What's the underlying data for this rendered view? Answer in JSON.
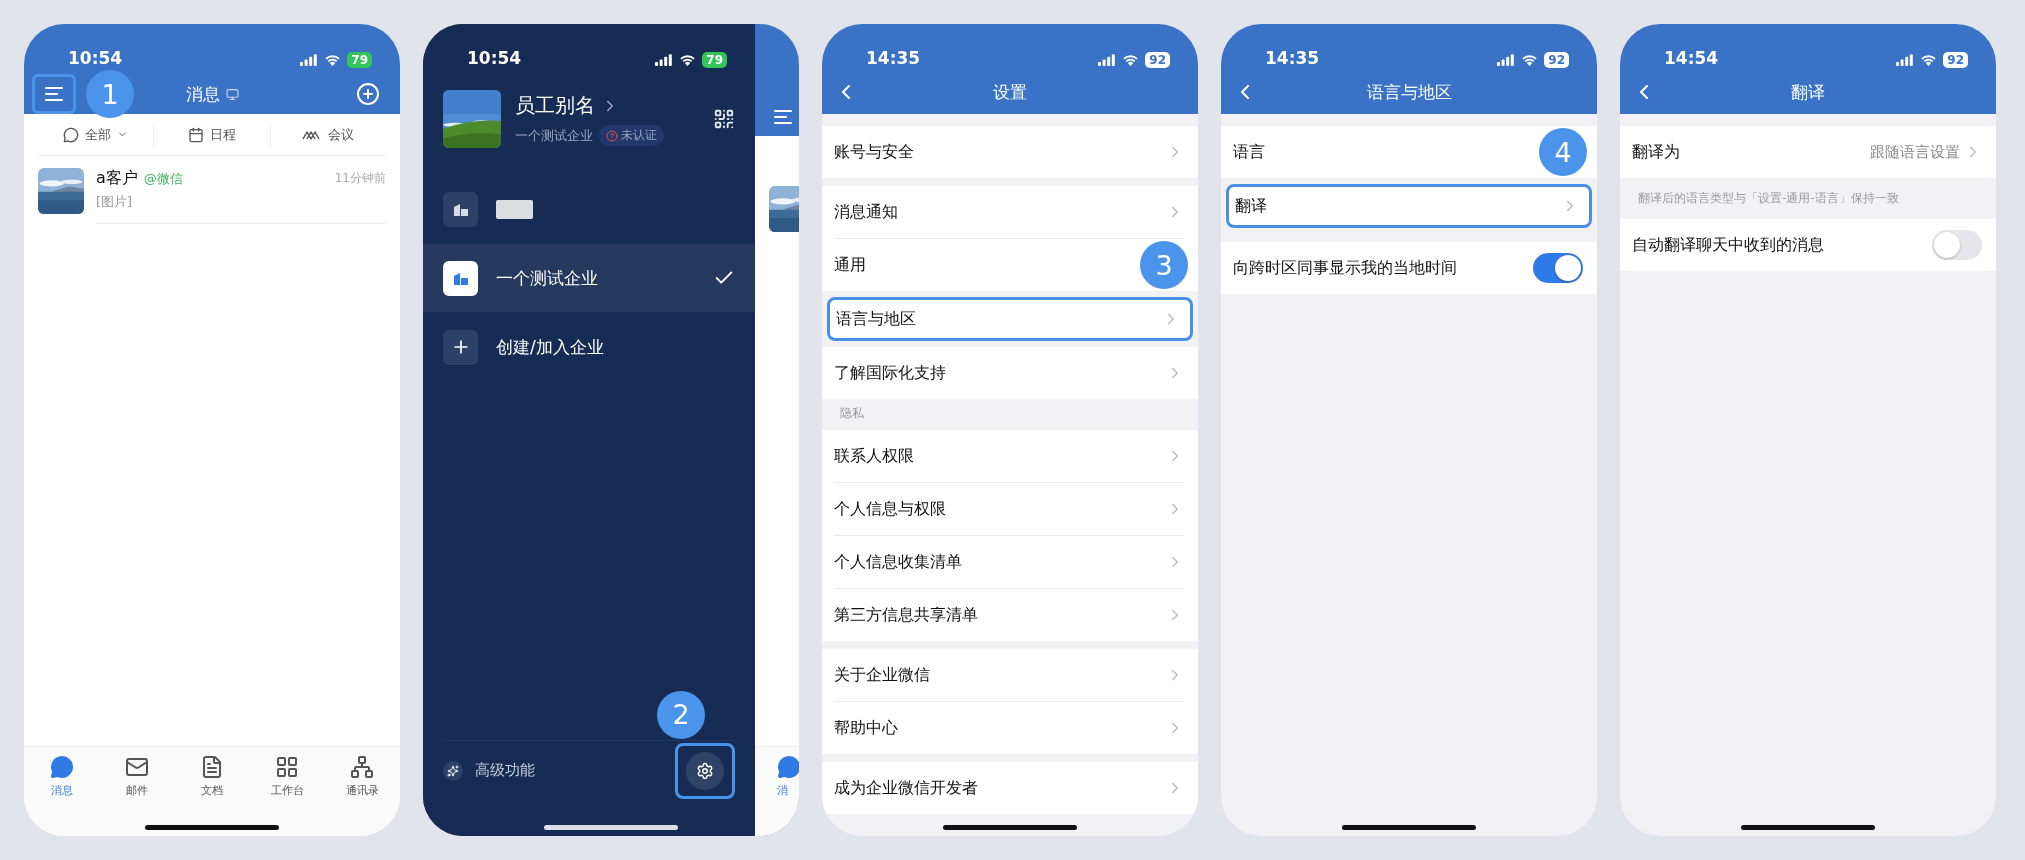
{
  "screens": [
    {
      "kind": "messages",
      "status": {
        "time": "10:54",
        "battery": "79",
        "charging": true
      },
      "title": "消息",
      "step": "1",
      "filters": [
        {
          "label": "全部",
          "dropdown": true
        },
        {
          "label": "日程",
          "dropdown": false
        },
        {
          "label": "会议",
          "dropdown": false
        }
      ],
      "chats": [
        {
          "name": "a客户",
          "source": "@微信",
          "time": "11分钟前",
          "preview": "[图片]"
        }
      ],
      "tabs": [
        {
          "label": "消息",
          "selected": true
        },
        {
          "label": "邮件",
          "selected": false
        },
        {
          "label": "文档",
          "selected": false
        },
        {
          "label": "工作台",
          "selected": false
        },
        {
          "label": "通讯录",
          "selected": false
        }
      ]
    },
    {
      "kind": "drawer",
      "status": {
        "time": "10:54",
        "battery": "79",
        "charging": true
      },
      "profile": {
        "name": "员工别名",
        "company": "一个测试企业",
        "badge": "未认证"
      },
      "orgs": [
        {
          "kind": "org",
          "redacted": true,
          "selected": false
        },
        {
          "kind": "org",
          "label": "一个测试企业",
          "redacted": false,
          "selected": true
        },
        {
          "kind": "create",
          "label": "创建/加入企业",
          "redacted": false,
          "selected": false
        }
      ],
      "footer": {
        "label": "高级功能",
        "step": "2"
      },
      "peek": {
        "tab": "消"
      }
    },
    {
      "kind": "settings",
      "status": {
        "time": "14:35",
        "battery": "92",
        "charging": false
      },
      "title": "设置",
      "groups": [
        {
          "rows": [
            {
              "kind": "link",
              "label": "账号与安全",
              "highlighted": false
            }
          ]
        },
        {
          "rows": [
            {
              "kind": "link",
              "label": "消息通知",
              "highlighted": false
            },
            {
              "kind": "link",
              "label": "通用",
              "highlighted": false,
              "step": "3"
            },
            {
              "kind": "link",
              "label": "语言与地区",
              "highlighted": true
            },
            {
              "kind": "link",
              "label": "了解国际化支持",
              "highlighted": false
            }
          ]
        },
        {
          "header": "隐私",
          "rows": [
            {
              "kind": "link",
              "label": "联系人权限",
              "highlighted": false
            },
            {
              "kind": "link",
              "label": "个人信息与权限",
              "highlighted": false
            },
            {
              "kind": "link",
              "label": "个人信息收集清单",
              "highlighted": false
            },
            {
              "kind": "link",
              "label": "第三方信息共享清单",
              "highlighted": false
            }
          ]
        },
        {
          "rows": [
            {
              "kind": "link",
              "label": "关于企业微信",
              "highlighted": false
            },
            {
              "kind": "link",
              "label": "帮助中心",
              "highlighted": false
            }
          ]
        },
        {
          "rows": [
            {
              "kind": "link",
              "label": "成为企业微信开发者",
              "highlighted": false
            }
          ]
        }
      ]
    },
    {
      "kind": "settings",
      "status": {
        "time": "14:35",
        "battery": "92",
        "charging": false
      },
      "title": "语言与地区",
      "groups": [
        {
          "rows": [
            {
              "kind": "link",
              "label": "语言",
              "highlighted": false,
              "step": "4"
            },
            {
              "kind": "link",
              "label": "翻译",
              "highlighted": true
            }
          ]
        },
        {
          "rows": [
            {
              "kind": "toggle",
              "label": "向跨时区同事显示我的当地时间",
              "highlighted": false,
              "on": true
            }
          ]
        }
      ]
    },
    {
      "kind": "settings",
      "status": {
        "time": "14:54",
        "battery": "92",
        "charging": false
      },
      "title": "翻译",
      "groups": [
        {
          "rows": [
            {
              "kind": "link",
              "label": "翻译为",
              "value": "跟随语言设置",
              "highlighted": false
            }
          ],
          "note": "翻译后的语言类型与「设置-通用-语言」保持一致"
        },
        {
          "rows": [
            {
              "kind": "toggle",
              "label": "自动翻译聊天中收到的消息",
              "highlighted": false,
              "on": false
            }
          ]
        }
      ]
    }
  ]
}
